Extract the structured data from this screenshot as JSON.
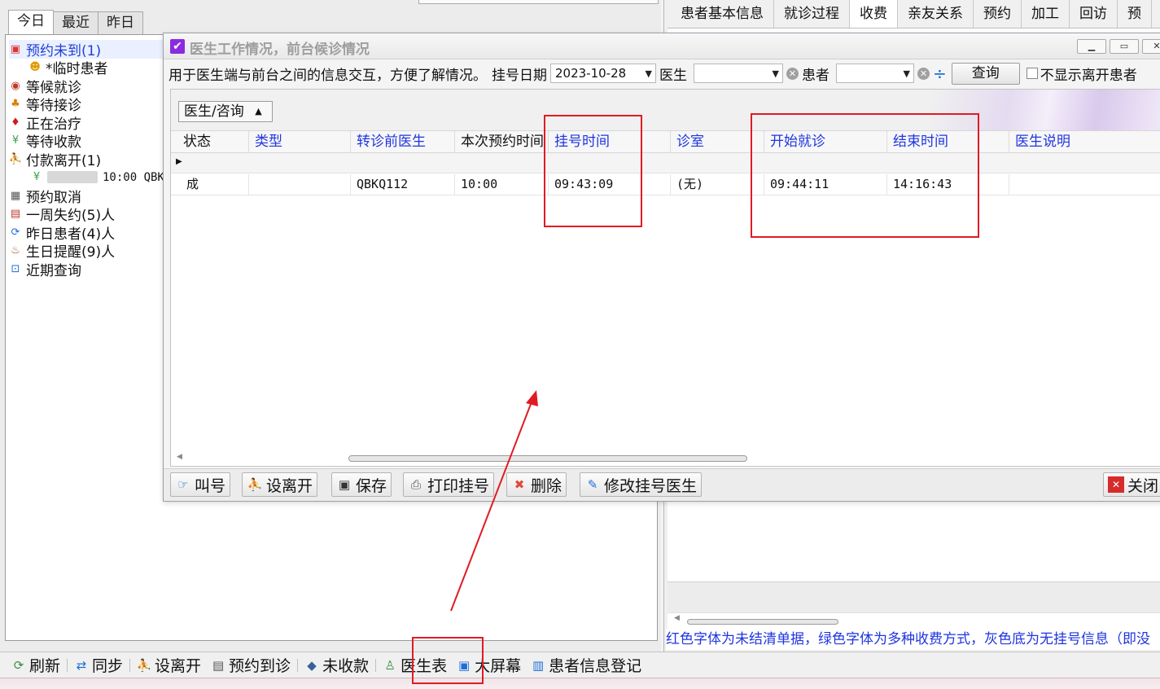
{
  "left": {
    "tabs": [
      "今日",
      "最近",
      "昨日"
    ],
    "items": [
      {
        "label": "预约未到(1)",
        "icon": "calendar-icon",
        "color": "#d33"
      },
      {
        "label": "*临时患者",
        "icon": "face-icon",
        "color": "#e09b00"
      },
      {
        "label": "等候就诊",
        "icon": "clock-icon",
        "color": "#c0392b"
      },
      {
        "label": "等待接诊",
        "icon": "doctor-icon",
        "color": "#e07b00"
      },
      {
        "label": "正在治疗",
        "icon": "treatment-icon",
        "color": "#d21b1b"
      },
      {
        "label": "等待收款",
        "icon": "yuan-icon",
        "color": "#3aa14a"
      },
      {
        "label": "付款离开(1)",
        "icon": "walk-icon",
        "color": "#111111"
      },
      {
        "label": "10:00 QBK",
        "icon": "yuan-icon",
        "color": "#3aa14a"
      },
      {
        "label": "预约取消",
        "icon": "cancel-calendar-icon",
        "color": "#555555"
      },
      {
        "label": "一周失约(5)人",
        "icon": "calendar-icon",
        "color": "#c0392b"
      },
      {
        "label": "昨日患者(4)人",
        "icon": "refresh-icon",
        "color": "#1f6fd8"
      },
      {
        "label": "生日提醒(9)人",
        "icon": "cake-icon",
        "color": "#a0522d"
      },
      {
        "label": "近期查询",
        "icon": "search-doc-icon",
        "color": "#1f6fd8"
      }
    ]
  },
  "right": {
    "tabs": [
      "患者基本信息",
      "就诊过程",
      "收费",
      "亲友关系",
      "预约",
      "加工",
      "回访",
      "预"
    ],
    "note": "红色字体为未结清单据，绿色字体为多种收费方式，灰色底为无挂号信息（即没"
  },
  "bottom_toolbar": [
    {
      "label": "刷新",
      "icon": "refresh-icon"
    },
    {
      "label": "同步",
      "icon": "sync-icon"
    },
    {
      "label": "设离开",
      "icon": "walk-icon"
    },
    {
      "label": "预约到诊",
      "icon": "list-icon"
    },
    {
      "label": "未收款",
      "icon": "tag-icon"
    },
    {
      "label": "医生表",
      "icon": "doctor-icon"
    },
    {
      "label": "大屏幕",
      "icon": "screen-icon"
    },
    {
      "label": "患者信息登记",
      "icon": "clipboard-icon"
    }
  ],
  "dialog": {
    "title": "医生工作情况，前台候诊情况",
    "filter": {
      "description": "用于医生端与前台之间的信息交互，方便了解情况。",
      "date_label": "挂号日期",
      "date_value": "2023-10-28",
      "doctor_label": "医生",
      "patient_label": "患者",
      "query_button": "查询",
      "hide_left_label": "不显示离开患者"
    },
    "group_by": "医生/咨询",
    "columns": [
      "状态",
      "类型",
      "转诊前医生",
      "本次预约时间",
      "挂号时间",
      "诊室",
      "开始就诊",
      "结束时间",
      "医生说明"
    ],
    "rows": [
      [
        "成",
        "",
        "QBKQ112",
        "10:00",
        "09:43:09",
        "(无)",
        "09:44:11",
        "14:16:43",
        ""
      ]
    ],
    "toolbar": [
      {
        "label": "叫号",
        "icon": "call-icon"
      },
      {
        "label": "设离开",
        "icon": "walk-icon"
      },
      {
        "label": "保存",
        "icon": "save-icon"
      },
      {
        "label": "打印挂号",
        "icon": "print-icon"
      },
      {
        "label": "删除",
        "icon": "delete-icon"
      },
      {
        "label": "修改挂号医生",
        "icon": "edit-doctor-icon"
      }
    ],
    "close_button": "关闭"
  },
  "colors": {
    "accent_blue": "#1f35e0",
    "annotation_red": "#e01b24",
    "title_check_purple": "#8a2be2"
  }
}
